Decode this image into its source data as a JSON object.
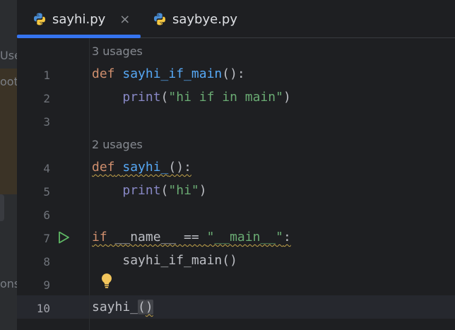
{
  "tabs": [
    {
      "label": "sayhi.py",
      "active": true,
      "closable": true,
      "icon": "python-file-icon",
      "close_glyph": "×"
    },
    {
      "label": "saybye.py",
      "active": false,
      "closable": false,
      "icon": "python-file-icon"
    }
  ],
  "left_panel": {
    "fragments": [
      "Use",
      "oot",
      "ons"
    ]
  },
  "editor": {
    "usage_hints": [
      "3 usages",
      "2 usages"
    ],
    "line_numbers": [
      "1",
      "2",
      "3",
      "4",
      "5",
      "6",
      "7",
      "8",
      "9",
      "10"
    ],
    "current_line": "10",
    "code": {
      "l1_kw": "def",
      "l1_fn": "sayhi_if_main",
      "l1_rest": "():",
      "l2_bi": "print",
      "l2_open": "(",
      "l2_str": "\"hi if in main\"",
      "l2_close": ")",
      "l4_kw": "def",
      "l4_fn": "sayhi_",
      "l4_rest": "():",
      "l5_bi": "print",
      "l5_open": "(",
      "l5_str": "\"hi\"",
      "l5_close": ")",
      "l7_kw": "if",
      "l7_mid": " __name__ == ",
      "l7_str": "\"__main__\"",
      "l7_colon": ":",
      "l8": "sayhi_if_main()",
      "l10_name": "sayhi_",
      "l10_open": "(",
      "l10_close": ")"
    }
  },
  "colors": {
    "accent": "#3574f0",
    "keyword": "#cf8e6d",
    "function": "#56a8f5",
    "string": "#6aab73",
    "builtin": "#8888c6"
  }
}
